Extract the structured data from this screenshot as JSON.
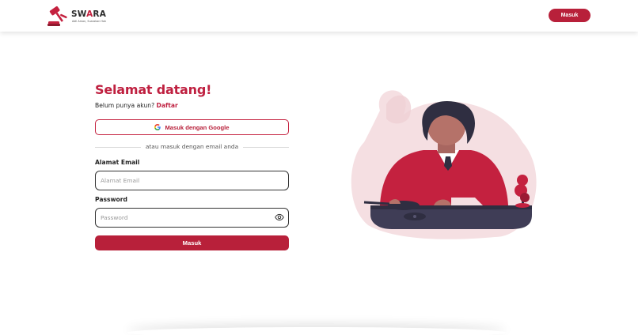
{
  "navbar": {
    "logo": {
      "name_part1": "SW",
      "name_part2": "A",
      "name_part3": "RA",
      "tagline": "Adil Aman, Suarakan Hak"
    },
    "login_button": "Masuk"
  },
  "form": {
    "title": "Selamat datang!",
    "signup_prompt": "Belum punya akun?",
    "signup_link": "Daftar",
    "google_button": "Masuk dengan Google",
    "divider_text": "atau masuk dengan email anda",
    "email": {
      "label": "Alamat Email",
      "placeholder": "Alamat Email",
      "value": ""
    },
    "password": {
      "label": "Password",
      "placeholder": "Password",
      "value": ""
    },
    "submit_button": "Masuk"
  },
  "colors": {
    "brand": "#b8203a",
    "brand_text": "#bf2040",
    "blush": "#f5dfe2"
  },
  "icons": {
    "google": "google-icon",
    "eye": "eye-icon",
    "logo": "gavel-icon"
  }
}
